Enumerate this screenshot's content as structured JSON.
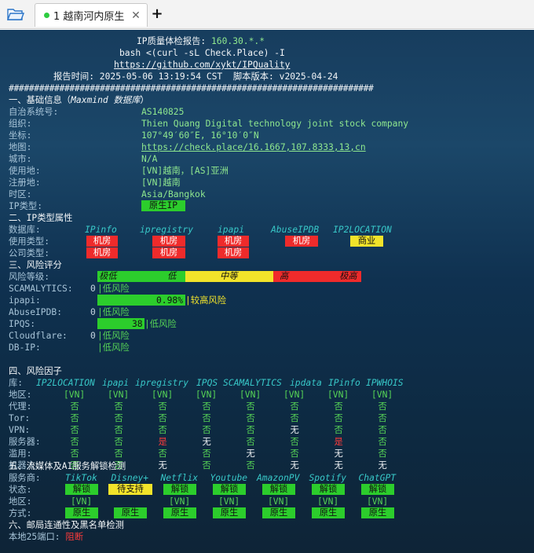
{
  "tab": {
    "title": "1 越南河内原生",
    "new_tab": "+"
  },
  "head": {
    "title": "IP质量体检报告: ",
    "ip": "160.30.*.*",
    "cmd": "bash <(curl -sL Check.Place) -I",
    "url": "https://github.com/xykt/IPQuality",
    "report_label": "报告时间: ",
    "report_time": "2025-05-06 13:19:54 CST",
    "version_label": "脚本版本: ",
    "version": "v2025-04-24",
    "rule": "########################################################################"
  },
  "s1": {
    "title": "一、基础信息（",
    "title_db": "Maxmind 数据库",
    "title_end": "）",
    "labels": [
      "自治系统号:",
      "组织:",
      "坐标:",
      "地图:",
      "城市:",
      "使用地:",
      "注册地:",
      "时区:",
      "IP类型:"
    ],
    "asn": "AS140825",
    "org": "Thien Quang Digital technology joint stock company",
    "coords": "107°49′60″E, 16°10′0″N",
    "map": "https://check.place/16.1667,107.8333,13,cn",
    "city": "N/A",
    "usage": "[VN]越南，[AS]亚洲",
    "reg": "[VN]越南",
    "tz": "Asia/Bangkok",
    "iptype": "原生IP"
  },
  "s2": {
    "title": "二、IP类型属性",
    "db_label": "数据库:",
    "use_label": "使用类型:",
    "co_label": "公司类型:",
    "dbs": [
      "IPinfo",
      "ipregistry",
      "ipapi",
      "AbuseIPDB",
      "IP2LOCATION"
    ],
    "use": [
      "机房",
      "机房",
      "机房",
      "机房",
      "商业"
    ],
    "co": [
      "机房",
      "机房",
      "机房"
    ],
    "use_colors": [
      "#ef2b2b",
      "#f2e32a"
    ]
  },
  "s3": {
    "title": "三、风险评分",
    "level_label": "风险等级:",
    "scale": [
      "极低",
      "低",
      "中等",
      "高",
      "极高"
    ],
    "rows": [
      {
        "label": "SCAMALYTICS:",
        "num": "0",
        "text": "低风险",
        "fill": 0
      },
      {
        "label": "ipapi:",
        "num": "0.98%",
        "text": "较高风险",
        "fill": 1
      },
      {
        "label": "AbuseIPDB:",
        "num": "0",
        "text": "低风险",
        "fill": 0
      },
      {
        "label": "IPQS:",
        "num": "38",
        "text": "低风险",
        "fill": 0.38
      },
      {
        "label": "Cloudflare:",
        "num": "0",
        "text": "低风险",
        "fill": 0
      },
      {
        "label": "DB-IP:",
        "num": "",
        "text": "低风险",
        "fill": 0
      }
    ]
  },
  "s4": {
    "title": "四、风险因子",
    "lib_label": "库: ",
    "libs": [
      "IP2LOCATION",
      "ipapi",
      "ipregistry",
      "IPQS",
      "SCAMALYTICS",
      "ipdata",
      "IPinfo",
      "IPWHOIS"
    ],
    "rows": [
      {
        "label": "地区:",
        "vals": [
          "[VN]",
          "[VN]",
          "[VN]",
          "[VN]",
          "[VN]",
          "[VN]",
          "[VN]",
          "[VN]"
        ]
      },
      {
        "label": "代理:",
        "vals": [
          "否",
          "否",
          "否",
          "否",
          "否",
          "否",
          "否",
          "否"
        ]
      },
      {
        "label": "Tor:",
        "vals": [
          "否",
          "否",
          "否",
          "否",
          "否",
          "否",
          "否",
          "否"
        ]
      },
      {
        "label": "VPN:",
        "vals": [
          "否",
          "否",
          "否",
          "否",
          "否",
          "无",
          "否",
          "否"
        ]
      },
      {
        "label": "服务器:",
        "vals": [
          "否",
          "否",
          "是",
          "无",
          "否",
          "否",
          "是",
          "否"
        ]
      },
      {
        "label": "滥用:",
        "vals": [
          "否",
          "否",
          "否",
          "否",
          "无",
          "否",
          "无",
          "否"
        ]
      },
      {
        "label": "机器人:",
        "vals": [
          "否",
          "否",
          "无",
          "否",
          "否",
          "无",
          "无",
          "无"
        ]
      }
    ]
  },
  "s5": {
    "title": "五、流媒体及AI服务解锁检测",
    "svc_label": "服务商:",
    "st_label": "状态:",
    "reg_label": "地区:",
    "way_label": "方式:",
    "services": [
      "TikTok",
      "Disney+",
      "Netflix",
      "Youtube",
      "AmazonPV",
      "Spotify",
      "ChatGPT"
    ],
    "status": [
      "解锁",
      "待支持",
      "解锁",
      "解锁",
      "解锁",
      "解锁",
      "解锁"
    ],
    "regions": [
      "[VN]",
      "",
      "[VN]",
      "[VN]",
      "[VN]",
      "[VN]",
      "[VN]"
    ],
    "methods": [
      "原生",
      "原生",
      "原生",
      "原生",
      "原生",
      "原生",
      "原生"
    ],
    "colors": {
      "ok": "#2ccd2c",
      "pending": "#f2e32a",
      "bad": "#ef2b2b"
    }
  },
  "s6": {
    "title": "六、邮局连通性及黑名单检测",
    "port_label": "本地25端口: ",
    "port_status": "阻断"
  }
}
